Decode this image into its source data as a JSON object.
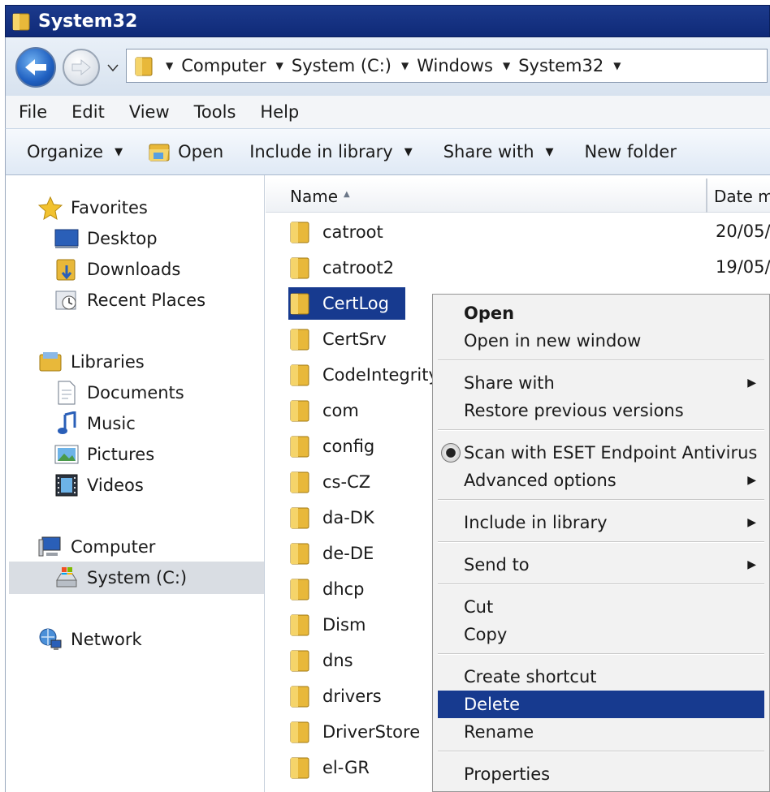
{
  "window": {
    "title": "System32"
  },
  "address": {
    "crumbs": [
      "Computer",
      "System (C:)",
      "Windows",
      "System32"
    ]
  },
  "menu": [
    "File",
    "Edit",
    "View",
    "Tools",
    "Help"
  ],
  "toolbar": {
    "organize": "Organize",
    "open": "Open",
    "include_in_library": "Include in library",
    "share_with": "Share with",
    "new_folder": "New folder"
  },
  "nav": {
    "favorites": "Favorites",
    "desktop": "Desktop",
    "downloads": "Downloads",
    "recent_places": "Recent Places",
    "libraries": "Libraries",
    "documents": "Documents",
    "music": "Music",
    "pictures": "Pictures",
    "videos": "Videos",
    "computer": "Computer",
    "system_c": "System (C:)",
    "network": "Network"
  },
  "columns": {
    "name": "Name",
    "date": "Date m"
  },
  "files": [
    {
      "name": "catroot",
      "date": "20/05/"
    },
    {
      "name": "catroot2",
      "date": "19/05/"
    },
    {
      "name": "CertLog",
      "date": ""
    },
    {
      "name": "CertSrv",
      "date": ""
    },
    {
      "name": "CodeIntegrity",
      "date": ""
    },
    {
      "name": "com",
      "date": ""
    },
    {
      "name": "config",
      "date": ""
    },
    {
      "name": "cs-CZ",
      "date": ""
    },
    {
      "name": "da-DK",
      "date": ""
    },
    {
      "name": "de-DE",
      "date": ""
    },
    {
      "name": "dhcp",
      "date": ""
    },
    {
      "name": "Dism",
      "date": ""
    },
    {
      "name": "dns",
      "date": ""
    },
    {
      "name": "drivers",
      "date": ""
    },
    {
      "name": "DriverStore",
      "date": ""
    },
    {
      "name": "el-GR",
      "date": ""
    }
  ],
  "context_menu": {
    "open": "Open",
    "open_new_window": "Open in new window",
    "share_with": "Share with",
    "restore_previous": "Restore previous versions",
    "scan_eset": "Scan with ESET Endpoint Antivirus",
    "advanced_options": "Advanced options",
    "include_in_library": "Include in library",
    "send_to": "Send to",
    "cut": "Cut",
    "copy": "Copy",
    "create_shortcut": "Create shortcut",
    "delete": "Delete",
    "rename": "Rename",
    "properties": "Properties"
  },
  "colors": {
    "selection": "#173a8f",
    "titlebar": "#1c3a8c",
    "folder": "#e8b83a"
  }
}
